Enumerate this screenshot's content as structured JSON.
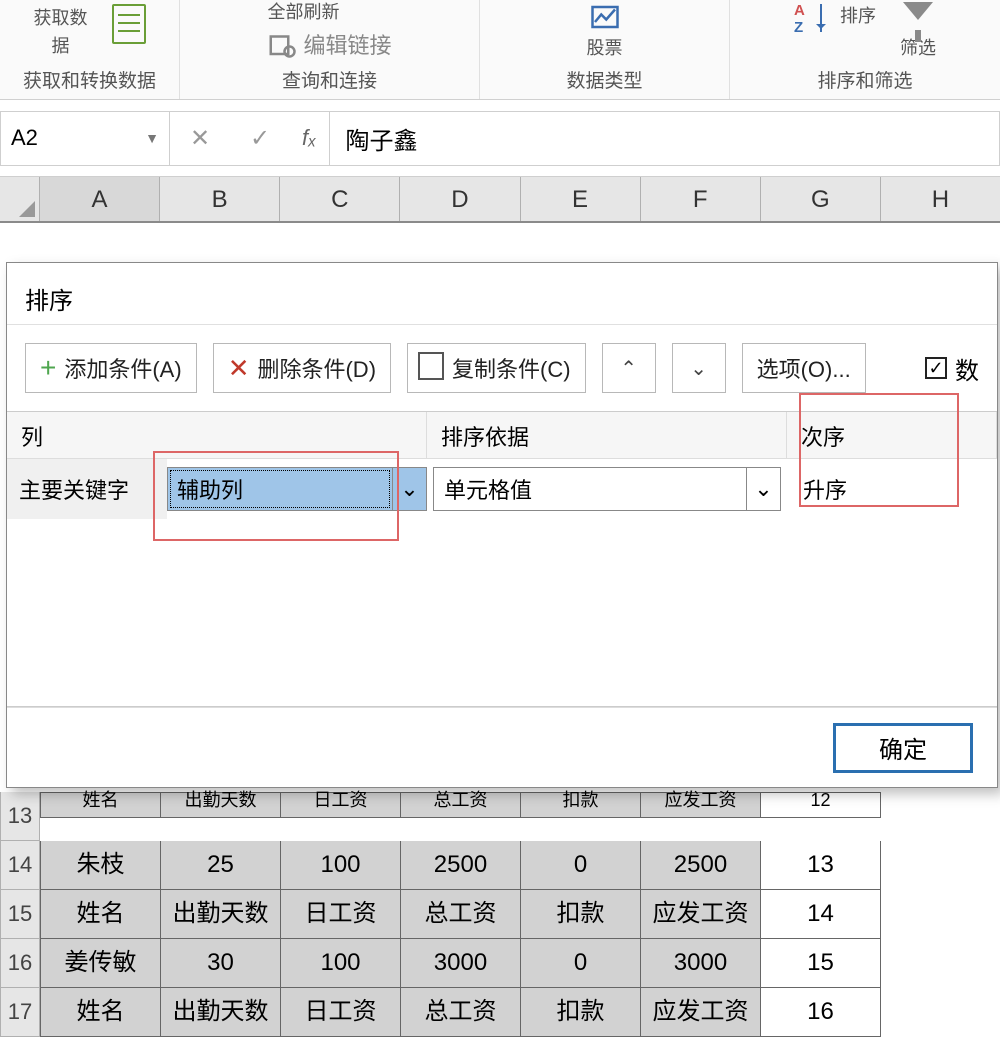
{
  "ribbon": {
    "group1": {
      "btn_get": "获取数",
      "btn_src": "据",
      "label": "获取和转换数据"
    },
    "group2": {
      "refresh": "全部刷新",
      "edit_link": "编辑链接",
      "label": "查询和连接"
    },
    "group3": {
      "stocks": "股票",
      "label": "数据类型"
    },
    "group4": {
      "sort_btn": "排序",
      "filter_btn": "筛选",
      "label": "排序和筛选"
    }
  },
  "formula_bar": {
    "name_box": "A2",
    "cancel": "✕",
    "enter": "✓",
    "fx": "fₓ",
    "value": "陶子鑫"
  },
  "columns": [
    "A",
    "B",
    "C",
    "D",
    "E",
    "F",
    "G",
    "H"
  ],
  "dialog": {
    "title": "排序",
    "add": "添加条件(A)",
    "delete": "删除条件(D)",
    "copy": "复制条件(C)",
    "options": "选项(O)...",
    "header_chk": "数",
    "col_header": "列",
    "basis_header": "排序依据",
    "order_header": "次序",
    "key_label": "主要关键字",
    "key_value": "辅助列",
    "basis_value": "单元格值",
    "order_value": "升序",
    "ok": "确定"
  },
  "rows": [
    {
      "num": "13",
      "cells": [
        "姓名",
        "出勤天数",
        "日工资",
        "总工资",
        "扣款",
        "应发工资",
        "12"
      ]
    },
    {
      "num": "14",
      "cells": [
        "朱枝",
        "25",
        "100",
        "2500",
        "0",
        "2500",
        "13"
      ]
    },
    {
      "num": "15",
      "cells": [
        "姓名",
        "出勤天数",
        "日工资",
        "总工资",
        "扣款",
        "应发工资",
        "14"
      ]
    },
    {
      "num": "16",
      "cells": [
        "姜传敏",
        "30",
        "100",
        "3000",
        "0",
        "3000",
        "15"
      ]
    },
    {
      "num": "17",
      "cells": [
        "姓名",
        "出勤天数",
        "日工资",
        "总工资",
        "扣款",
        "应发工资",
        "16"
      ]
    }
  ]
}
